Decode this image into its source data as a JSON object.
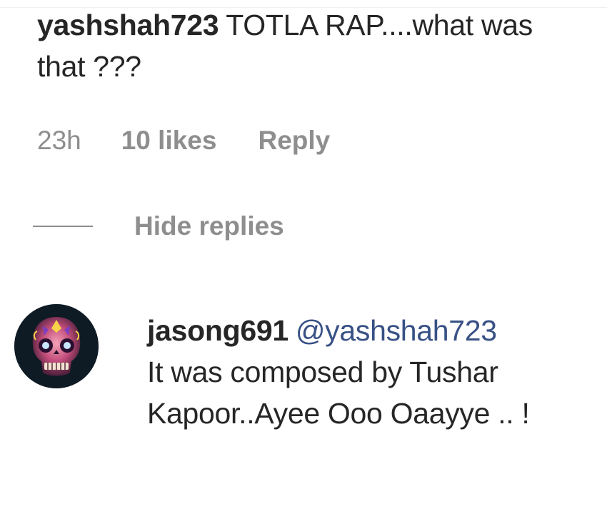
{
  "comment": {
    "username": "yashshah723",
    "text": "TOTLA RAP....what was that ???",
    "time": "23h",
    "likes": "10 likes",
    "reply_label": "Reply"
  },
  "replies_toggle": {
    "label": "Hide replies"
  },
  "reply": {
    "username": "jasong691",
    "mention": "@yashshah723",
    "text": "It was composed by Tushar Kapoor..Ayee Ooo Oaayye .. !",
    "avatar_icon": "skull-avatar-icon"
  },
  "colors": {
    "text": "#262626",
    "secondary": "#8e8e8e",
    "mention": "#385185"
  }
}
